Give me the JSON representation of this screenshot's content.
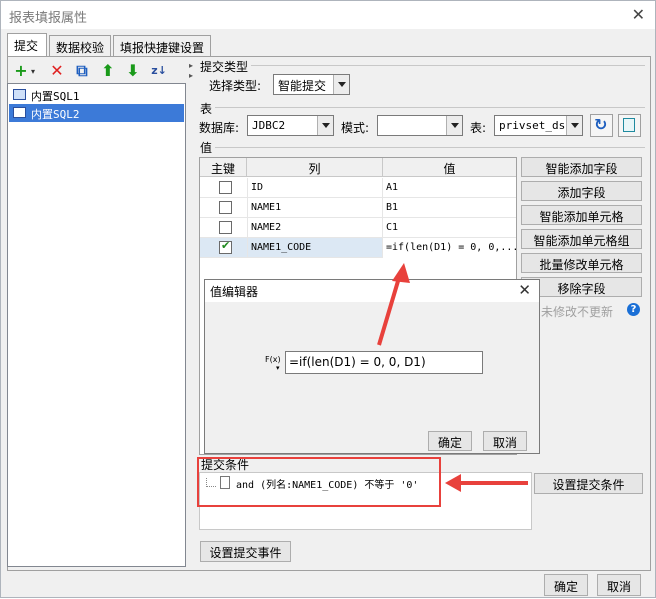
{
  "window": {
    "title": "报表填报属性"
  },
  "tabs": [
    "提交",
    "数据校验",
    "填报快捷键设置"
  ],
  "sidebar": {
    "toolbar": [
      "+",
      "✕",
      "⧉",
      "⬆",
      "⬇",
      "z↓"
    ],
    "items": [
      "内置SQL1",
      "内置SQL2"
    ],
    "selected_index": 1
  },
  "submit_type": {
    "section_label": "提交类型",
    "select_label": "选择类型:",
    "value": "智能提交"
  },
  "table_section": {
    "section_label": "表",
    "db_label": "数据库:",
    "db_value": "JDBC2",
    "mode_label": "模式:",
    "mode_value": "",
    "table_label": "表:",
    "table_value": "privset_ds"
  },
  "value_section": {
    "section_label": "值",
    "columns": [
      "主键",
      "列",
      "值"
    ],
    "rows": [
      {
        "pk": false,
        "col": "ID",
        "val": "A1"
      },
      {
        "pk": false,
        "col": "NAME1",
        "val": "B1"
      },
      {
        "pk": false,
        "col": "NAME2",
        "val": "C1"
      },
      {
        "pk": true,
        "col": "NAME1_CODE",
        "val": "=if(len(D1) = 0, 0,..."
      }
    ],
    "buttons": [
      "智能添加字段",
      "添加字段",
      "智能添加单元格",
      "智能添加单元格组",
      "批量修改单元格",
      "移除字段"
    ],
    "unmodified_label": "未修改不更新"
  },
  "value_editor": {
    "title": "值编辑器",
    "fx_label": "F(x)",
    "formula": "=if(len(D1) = 0, 0, D1)",
    "ok": "确定",
    "cancel": "取消"
  },
  "condition_section": {
    "section_label": "提交条件",
    "condition": "and (列名:NAME1_CODE) 不等于 '0'",
    "set_button": "设置提交条件"
  },
  "events_button": "设置提交事件",
  "footer": {
    "ok": "确定",
    "cancel": "取消"
  },
  "colors": {
    "selection": "#3c7ad8",
    "annotation": "#e8413c"
  }
}
